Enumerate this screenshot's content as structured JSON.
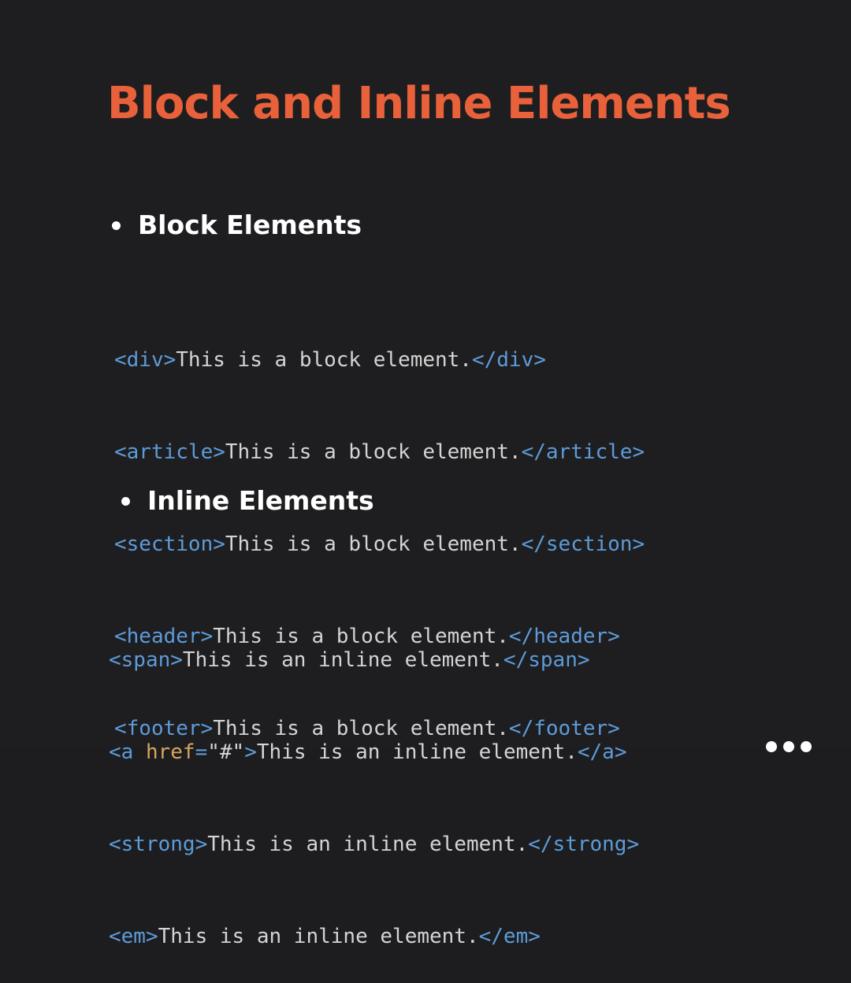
{
  "title": "Block and Inline Elements",
  "colors": {
    "background": "#1e1e20",
    "title": "#e8613a",
    "heading": "#ffffff",
    "tag": "#5d9bd9",
    "text": "#d4d4d4",
    "attr": "#d9a45f"
  },
  "block_section": {
    "heading": "Block Elements",
    "lines": [
      {
        "open": "<div>",
        "text": "This is a block element.",
        "close": "</div>"
      },
      {
        "open": "<article>",
        "text": "This is a block element.",
        "close": "</article>"
      },
      {
        "open": "<section>",
        "text": "This is a block element.",
        "close": "</section>"
      },
      {
        "open": "<header>",
        "text": "This is a block element.",
        "close": "</header>"
      },
      {
        "open": "<footer>",
        "text": "This is a block element.",
        "close": "</footer>"
      }
    ]
  },
  "inline_section": {
    "heading": "Inline Elements",
    "lines": [
      {
        "open": "<span>",
        "text": "This is an inline element.",
        "close": "</span>"
      },
      {
        "open_start": "<a ",
        "attr_name": "href",
        "attr_eq": "=",
        "attr_value": "\"#\"",
        "open_end": ">",
        "text": "This is an inline element.",
        "close": "</a>"
      },
      {
        "open": "<strong>",
        "text": "This is an inline element.",
        "close": "</strong>"
      },
      {
        "open": "<em>",
        "text": "This is an inline element.",
        "close": "</em>"
      }
    ]
  }
}
